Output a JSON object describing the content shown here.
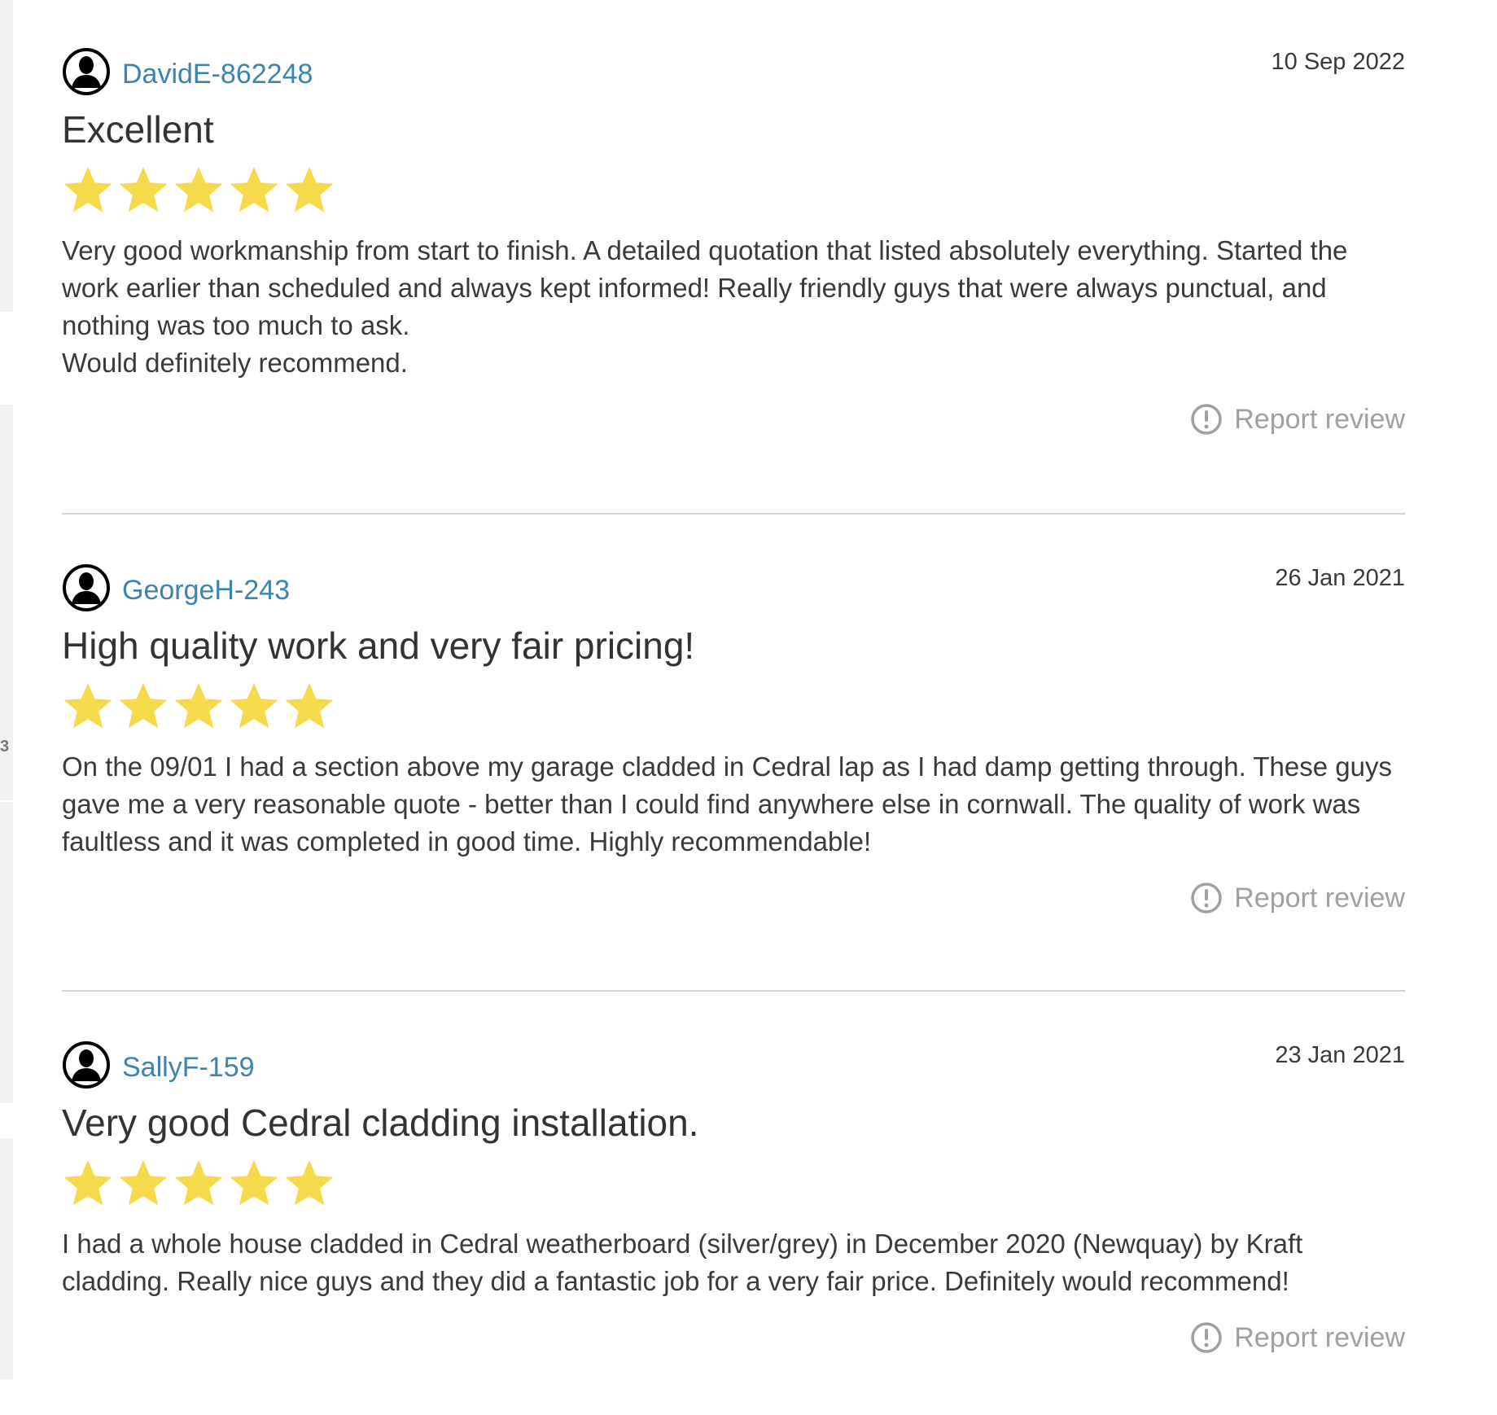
{
  "sidebar_fragment": {
    "label": "3"
  },
  "reviews": [
    {
      "username": "DavidE-862248",
      "date": "10 Sep 2022",
      "title": "Excellent",
      "rating": 5,
      "body": [
        "Very good workmanship from start to finish. A detailed quotation that listed absolutely everything. Started the work earlier than scheduled and always kept informed! Really friendly guys that were always punctual, and nothing was too much to ask.",
        "Would definitely recommend."
      ],
      "report_label": "Report review"
    },
    {
      "username": "GeorgeH-243",
      "date": "26 Jan 2021",
      "title": "High quality work and very fair pricing!",
      "rating": 5,
      "body": [
        "On the 09/01 I had a section above my garage cladded in Cedral lap as I had damp getting through. These guys gave me a very reasonable quote - better than I could find anywhere else in cornwall. The quality of work was faultless and it was completed in good time. Highly recommendable!"
      ],
      "report_label": "Report review"
    },
    {
      "username": "SallyF-159",
      "date": "23 Jan 2021",
      "title": "Very good Cedral cladding installation.",
      "rating": 5,
      "body": [
        "I had a whole house cladded in Cedral weatherboard (silver/grey) in December 2020 (Newquay) by Kraft cladding. Really nice guys and they did a fantastic job for a very fair price. Definitely would recommend!"
      ],
      "report_label": "Report review"
    }
  ],
  "colors": {
    "username": "#3c84ad",
    "star": "#f7d94c",
    "report": "#a0a0a0",
    "divider": "#d4d4d6"
  },
  "icons": {
    "avatar": "user-silhouette-icon",
    "star": "star-icon",
    "report": "exclamation-circle-icon"
  }
}
